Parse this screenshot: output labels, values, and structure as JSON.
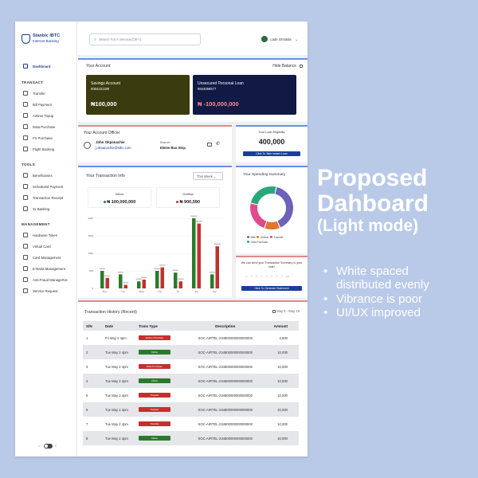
{
  "sidebar": {
    "brand_line1": "Stanbic IBTC",
    "brand_line2": "Internet Banking",
    "dashboard": "Dashboard",
    "sections": {
      "transact": "TRANSACT",
      "tools": "TOOLS",
      "management": "MANAGEMENT"
    },
    "transact_items": [
      "Transfer",
      "Bill Payment",
      "Airtime Topup",
      "Data Purchase",
      "FX Purchase",
      "Flight Booking"
    ],
    "tools_items": [
      "Beneficiaries",
      "Scheduled Payment",
      "Transaction Receipt",
      "3x Banking"
    ],
    "management_items": [
      "Hardware Token",
      "Virtual Card",
      "Card Management",
      "E-Naira Management",
      "Anti-Fraud Manage#os",
      "Service Request"
    ]
  },
  "topbar": {
    "search_placeholder": "Search For A Service(Ctrl+/)",
    "user_name": "Lade Omotola"
  },
  "account": {
    "title": "Your Account",
    "hide_balance": "Hide Balance",
    "savings": {
      "label": "Savings Account",
      "number": "0054231189",
      "balance": "₦100,000",
      "color": "#3b3b10"
    },
    "loan": {
      "label": "Unsecured Personal Loan",
      "number": "9944056577",
      "balance": "₦ -100,000,000",
      "color": "#101a45"
    }
  },
  "officer": {
    "title": "Your Account Officer",
    "name": "John Okpanachie",
    "email": "j.okpanachie@stbc.com",
    "branch_label": "Branch",
    "branch": "Eleme Bus Stop"
  },
  "loan_eligibility": {
    "title": "Your Loan Eligibility",
    "amount": "400,000",
    "button": "Click To Take Instant Loan"
  },
  "transaction_info": {
    "title": "Your Transaction Info",
    "period": "This Week",
    "inflow_label": "Inflow",
    "inflow_value": "₦ 100,000,000",
    "outflow_label": "Outflow",
    "outflow_value": "₦ 900,590"
  },
  "chart_data": {
    "type": "bar",
    "categories": [
      "Mon",
      "Tue",
      "Wed",
      "Thu",
      "Fri",
      "Sat",
      "Sun"
    ],
    "series": [
      {
        "name": "Inflow",
        "values": [
          500000,
          400000,
          200000,
          500000,
          450000,
          2000000,
          400000
        ],
        "color": "#2b7a2b"
      },
      {
        "name": "Outflow",
        "values": [
          300000,
          100000,
          250000,
          600000,
          200000,
          1850000,
          1200000
        ],
        "color": "#c23030"
      }
    ],
    "ylim": [
      0,
      2000000
    ],
    "y_ticks": [
      "2000",
      "1500",
      "1000",
      "500",
      "0"
    ]
  },
  "spending": {
    "title": "Your Spending Summary",
    "legend": [
      "Bills",
      "Airtime",
      "Transfer",
      "Data Purchase"
    ],
    "slices": [
      {
        "name": "Bills",
        "value": 40,
        "color": "#6c62b8"
      },
      {
        "name": "Airtime",
        "value": 12,
        "color": "#e8732c"
      },
      {
        "name": "Transfer",
        "value": 23,
        "color": "#e04b8c"
      },
      {
        "name": "Data Purchase",
        "value": 25,
        "color": "#28a87a"
      }
    ]
  },
  "rating": {
    "question": "We can send your Transaction Summary to your mail?",
    "button": "Click To Generate Statement"
  },
  "history": {
    "title": "Transaction History (Recent)",
    "date_range": "May 5 - May 18",
    "headers": [
      "S/N",
      "Date",
      "Trans Type",
      "Description",
      "Amount"
    ],
    "rows": [
      {
        "sn": "1",
        "date": "Fri May 2  4pm",
        "type": "Airtime Purchase",
        "kind": "red",
        "desc": "SOC-AIRTEL-234800000000000000",
        "amount": "3,500"
      },
      {
        "sn": "2",
        "date": "Tue May 2  4pm",
        "type": "Inflow",
        "kind": "green",
        "desc": "SOC-AIRTEL-234800000000000000",
        "amount": "10,000"
      },
      {
        "sn": "3",
        "date": "Tue May 2  4pm",
        "type": "Data Purchase",
        "kind": "red",
        "desc": "SOC-AIRTEL-234800000000000000",
        "amount": "10,000"
      },
      {
        "sn": "4",
        "date": "Tue May 2  4pm",
        "type": "Inflow",
        "kind": "green",
        "desc": "SOC-AIRTEL-234800000000000000",
        "amount": "10,000"
      },
      {
        "sn": "5",
        "date": "Tue May 2  4pm",
        "type": "Transfer",
        "kind": "red",
        "desc": "SOC-AIRTEL-234800000000000000",
        "amount": "10,000"
      },
      {
        "sn": "6",
        "date": "Tue May 2  4pm",
        "type": "Transfer",
        "kind": "red",
        "desc": "SOC-AIRTEL-234800000000000000",
        "amount": "10,000"
      },
      {
        "sn": "7",
        "date": "Tue May 2  4pm",
        "type": "Transfer",
        "kind": "red",
        "desc": "SOC-AIRTEL-234800000000000000",
        "amount": "10,000"
      },
      {
        "sn": "8",
        "date": "Tue May 2  4pm",
        "type": "Inflow",
        "kind": "green",
        "desc": "SOC-AIRTEL-234800000000000000",
        "amount": "10,000"
      }
    ]
  },
  "annotation": {
    "heading": "Proposed Dahboard",
    "subheading": "(Light mode)",
    "bullets": [
      "White spaced distributed evenly",
      "Vibrance is poor",
      "UI/UX improved"
    ]
  }
}
